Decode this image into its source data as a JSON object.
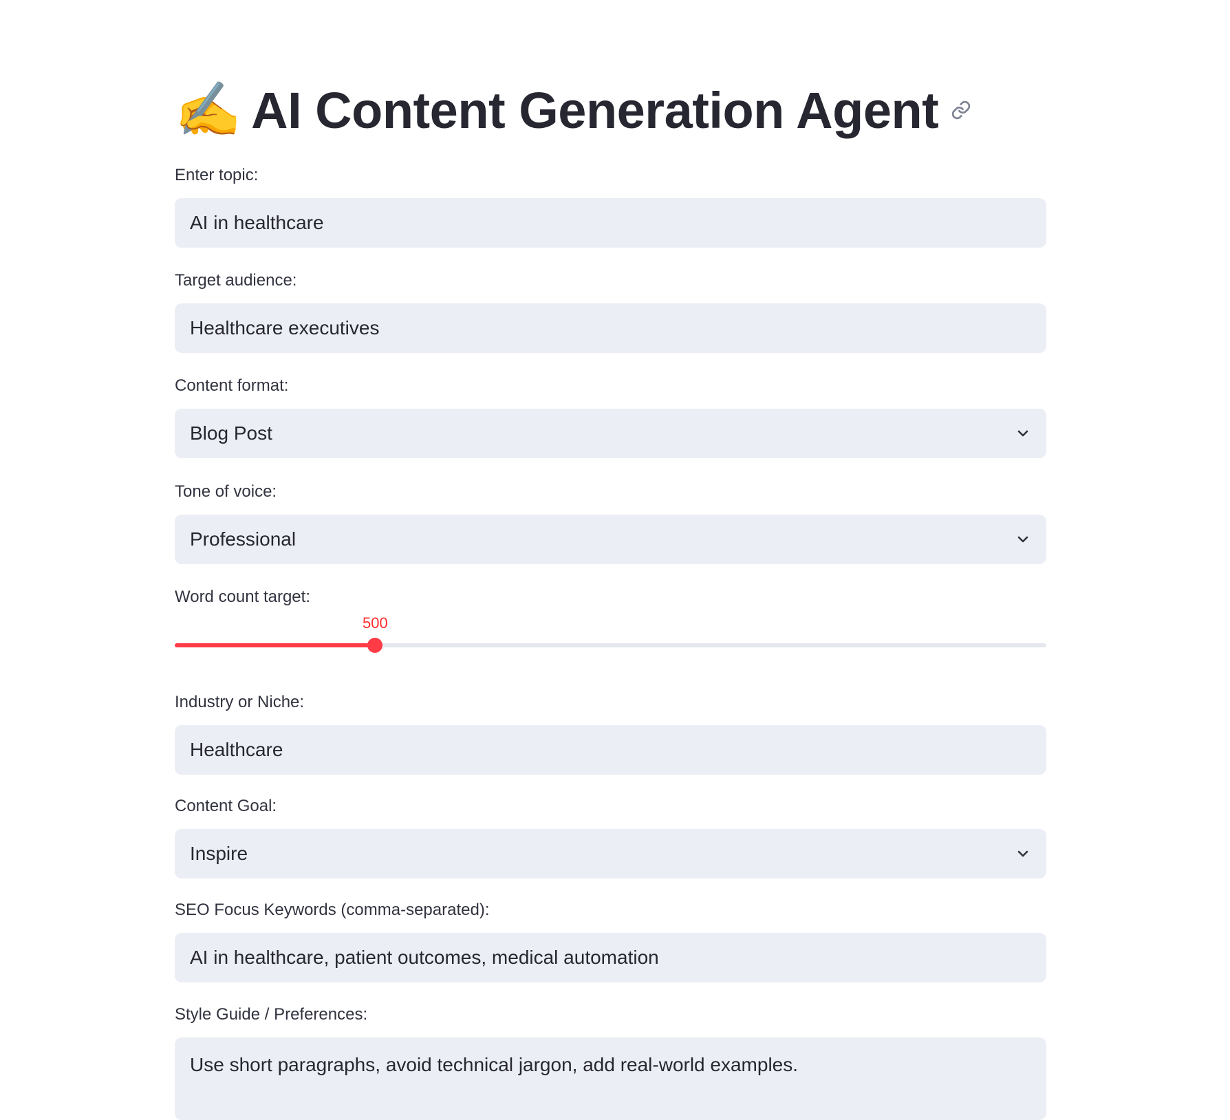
{
  "header": {
    "emoji": "✍️",
    "title": "AI Content Generation Agent",
    "anchor_icon": "link-icon"
  },
  "fields": {
    "topic": {
      "label": "Enter topic:",
      "value": "AI in healthcare"
    },
    "audience": {
      "label": "Target audience:",
      "value": "Healthcare executives"
    },
    "format": {
      "label": "Content format:",
      "value": "Blog Post",
      "icon": "chevron-down-icon"
    },
    "tone": {
      "label": "Tone of voice:",
      "value": "Professional",
      "icon": "chevron-down-icon"
    },
    "word_count": {
      "label": "Word count target:",
      "value": "500",
      "fill_fraction": 0.23
    },
    "industry": {
      "label": "Industry or Niche:",
      "value": "Healthcare"
    },
    "goal": {
      "label": "Content Goal:",
      "value": "Inspire",
      "icon": "chevron-down-icon"
    },
    "seo": {
      "label": "SEO Focus Keywords (comma-separated):",
      "value": "AI in healthcare, patient outcomes, medical automation"
    },
    "style": {
      "label": "Style Guide / Preferences:",
      "value": "Use short paragraphs, avoid technical jargon, add real-world examples."
    }
  },
  "colors": {
    "accent": "#ff3b46",
    "input_bg": "#eceef5",
    "text": "#31333f"
  }
}
